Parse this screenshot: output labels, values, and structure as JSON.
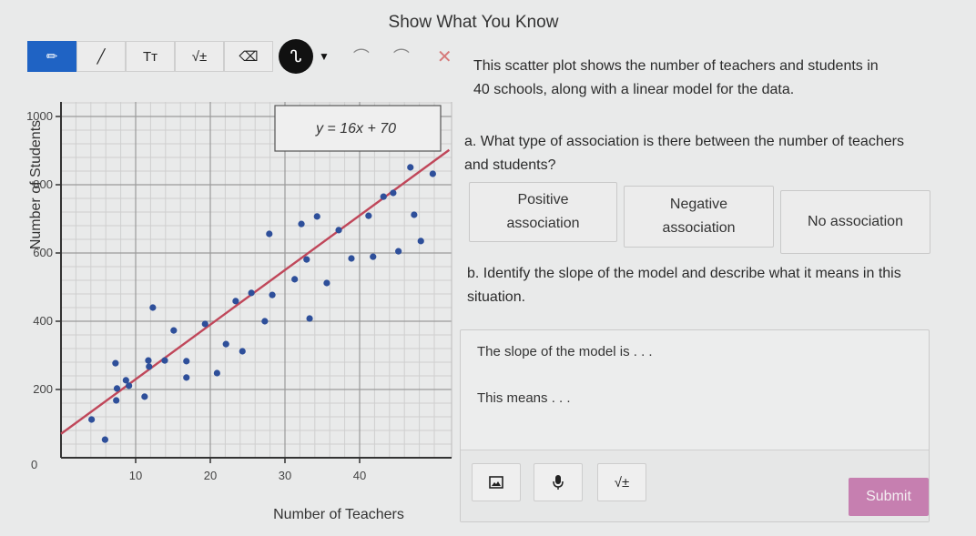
{
  "header": {
    "title": "Show What You Know"
  },
  "toolbar": {
    "tools": [
      {
        "name": "pencil",
        "icon": "✏",
        "active": true
      },
      {
        "name": "line",
        "icon": "╱",
        "active": false
      },
      {
        "name": "text",
        "icon": "Tт",
        "active": false
      },
      {
        "name": "math",
        "icon": "√±",
        "active": false
      },
      {
        "name": "eraser",
        "icon": "⌫",
        "active": false
      }
    ],
    "pen_color_icon": "ᔐ",
    "pen_color": "#111111",
    "dropdown_icon": "▼",
    "undo_icon": "⌒",
    "redo_icon": "⌒",
    "clear_icon": "✕"
  },
  "prompt": {
    "line1": "This scatter plot shows the number of teachers and students in",
    "line2": "40  schools, along with a linear model for the data."
  },
  "question_a": {
    "text": "a. What type of association is there between the number of teachers and students?",
    "choices": [
      {
        "line1": "Positive",
        "line2": "association"
      },
      {
        "line1": "Negative",
        "line2": "association"
      },
      {
        "line1": "No association",
        "line2": ""
      }
    ]
  },
  "question_b": {
    "text": "b. Identify the slope of the model and describe what it means in this situation."
  },
  "answer": {
    "line1": "The slope of the model is . . .",
    "line2": "This means . . .",
    "buttons": {
      "image_icon": "🖼",
      "mic_icon": "🎙",
      "math_icon": "√±"
    },
    "submit_label": "Submit"
  },
  "colors": {
    "accent_blue": "#1f63c4",
    "point_color": "#2e4f9a",
    "line_color": "#c0475a",
    "submit_bg": "#c67fb0"
  },
  "chart_data": {
    "type": "scatter",
    "title": "",
    "xlabel": "Number of Teachers",
    "ylabel": "Number of Students",
    "xlim": [
      0,
      50
    ],
    "ylim": [
      0,
      1050
    ],
    "xticks": [
      10,
      20,
      30,
      40
    ],
    "yticks": [
      200,
      400,
      600,
      800,
      1000
    ],
    "ytick_labels": [
      "200",
      "400",
      "600",
      "800",
      "1000"
    ],
    "origin_label": "0",
    "grid": true,
    "model": {
      "label": "y = 16x + 70",
      "slope": 16,
      "intercept": 70
    },
    "points": [
      [
        4.1,
        112
      ],
      [
        5.9,
        53
      ],
      [
        7.3,
        277
      ],
      [
        7.5,
        203
      ],
      [
        7.4,
        168
      ],
      [
        8.7,
        227
      ],
      [
        9.1,
        211
      ],
      [
        11.7,
        285
      ],
      [
        11.8,
        267
      ],
      [
        12.3,
        440
      ],
      [
        13.9,
        285
      ],
      [
        16.8,
        283
      ],
      [
        16.8,
        235
      ],
      [
        11.2,
        179
      ],
      [
        15.1,
        373
      ],
      [
        19.3,
        392
      ],
      [
        20.9,
        248
      ],
      [
        22.1,
        333
      ],
      [
        24.3,
        312
      ],
      [
        23.4,
        459
      ],
      [
        25.5,
        483
      ],
      [
        27.3,
        400
      ],
      [
        28.3,
        477
      ],
      [
        33.3,
        408
      ],
      [
        31.3,
        523
      ],
      [
        27.9,
        656
      ],
      [
        32.2,
        685
      ],
      [
        34.3,
        707
      ],
      [
        32.9,
        581
      ],
      [
        35.6,
        512
      ],
      [
        37.2,
        667
      ],
      [
        38.9,
        584
      ],
      [
        41.2,
        709
      ],
      [
        41.8,
        589
      ],
      [
        43.2,
        765
      ],
      [
        44.5,
        776
      ],
      [
        45.2,
        605
      ],
      [
        47.3,
        712
      ],
      [
        46.8,
        851
      ],
      [
        48.2,
        635
      ],
      [
        49.8,
        832
      ]
    ]
  }
}
